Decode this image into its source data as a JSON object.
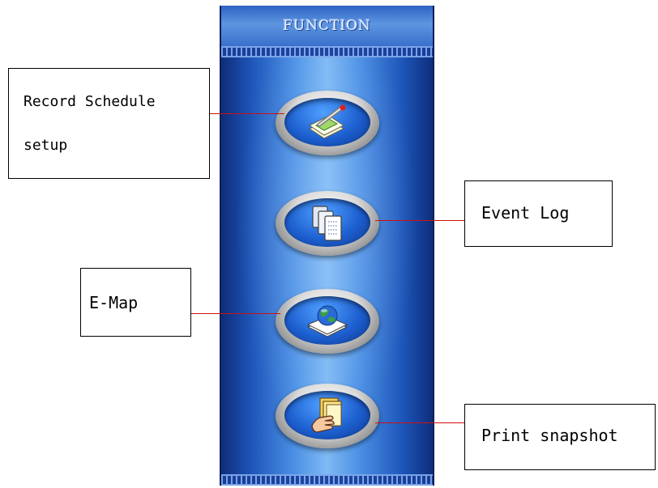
{
  "panel": {
    "title": "FUNCTION",
    "accent_color": "#1d55b8",
    "leader_color": "#d01010",
    "buttons": [
      {
        "id": "record-schedule",
        "icon": "pencil-paper-icon"
      },
      {
        "id": "event-log",
        "icon": "documents-icon"
      },
      {
        "id": "e-map",
        "icon": "globe-icon"
      },
      {
        "id": "print-snapshot",
        "icon": "hand-folder-icon"
      }
    ]
  },
  "callouts": {
    "record_schedule": {
      "line1": "Record Schedule",
      "line2": "setup"
    },
    "event_log": "Event Log",
    "e_map": "E-Map",
    "print_snapshot": "Print snapshot"
  }
}
